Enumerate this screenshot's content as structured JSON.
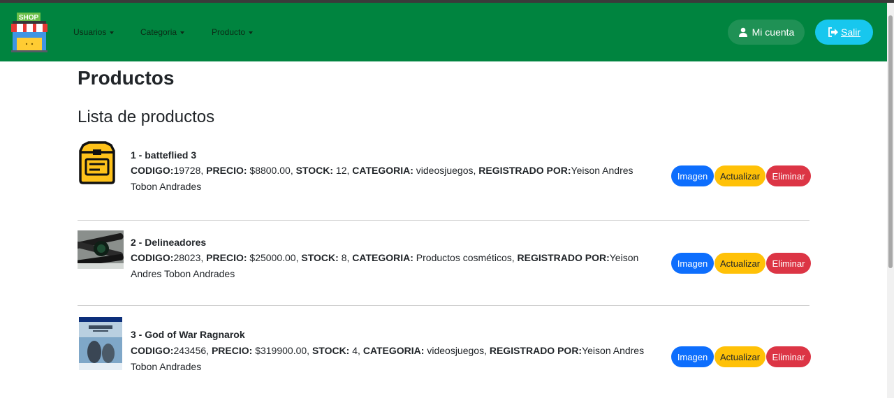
{
  "navbar": {
    "logo_text": "SHOP",
    "menu": [
      {
        "label": "Usuarios"
      },
      {
        "label": "Categoria"
      },
      {
        "label": "Producto"
      }
    ],
    "account_label": "Mi cuenta",
    "exit_label": "Salir",
    "colors": {
      "bar": "#00843f",
      "account": "#1f9155",
      "exit": "#17c7ee"
    }
  },
  "page": {
    "title": "Productos",
    "subtitle": "Lista de productos"
  },
  "labels": {
    "codigo": "CODIGO:",
    "precio": "PRECIO:",
    "stock": "STOCK:",
    "categoria": "CATEGORIA:",
    "registrado": "REGISTRADO POR:"
  },
  "actions": {
    "image": "Imagen",
    "update": "Actualizar",
    "delete": "Eliminar"
  },
  "products": [
    {
      "name": "1 - batteflied 3",
      "codigo": "19728",
      "precio": "$8800.00",
      "stock": "12",
      "categoria": "videosjuegos",
      "registrado": "Yeison Andres Tobon Andrades",
      "image": "box-icon"
    },
    {
      "name": "2 - Delineadores",
      "codigo": "28023",
      "precio": "$25000.00",
      "stock": "8",
      "categoria": "Productos cosméticos",
      "registrado": "Yeison Andres Tobon Andrades",
      "image": "eyeliner-photo"
    },
    {
      "name": "3 - God of War Ragnarok",
      "codigo": "243456",
      "precio": "$319900.00",
      "stock": "4",
      "categoria": "videosjuegos",
      "registrado": "Yeison Andres Tobon Andrades",
      "image": "game-cover-photo"
    }
  ]
}
